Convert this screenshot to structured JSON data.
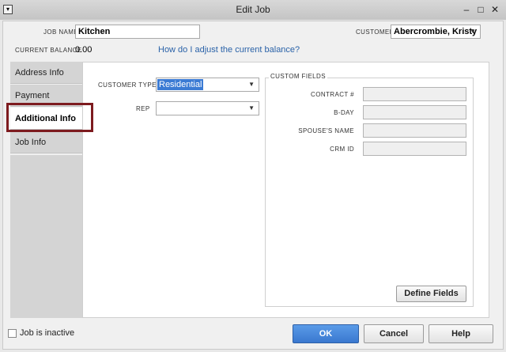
{
  "window": {
    "title": "Edit Job"
  },
  "header": {
    "job_name_label": "JOB NAME",
    "job_name_value": "Kitchen",
    "customer_label": "CUSTOMER",
    "customer_value": "Abercrombie, Kristy",
    "current_balance_label": "CURRENT BALANCE",
    "current_balance_value": "0.00",
    "balance_link": "How do I adjust the current balance?"
  },
  "tabs": [
    {
      "label": "Address Info"
    },
    {
      "label": "Payment Settings"
    },
    {
      "label": "Additional Info"
    },
    {
      "label": "Job Info"
    }
  ],
  "additional_info": {
    "customer_type_label": "CUSTOMER TYPE",
    "customer_type_value": "Residential",
    "rep_label": "REP",
    "rep_value": ""
  },
  "custom_fields": {
    "title": "CUSTOM FIELDS",
    "fields": [
      {
        "label": "CONTRACT #",
        "value": ""
      },
      {
        "label": "B-DAY",
        "value": ""
      },
      {
        "label": "SPOUSE'S NAME",
        "value": ""
      },
      {
        "label": "CRM ID",
        "value": ""
      }
    ],
    "define_button": "Define Fields"
  },
  "footer": {
    "inactive_label": "Job is inactive",
    "ok_label": "OK",
    "cancel_label": "Cancel",
    "help_label": "Help"
  }
}
